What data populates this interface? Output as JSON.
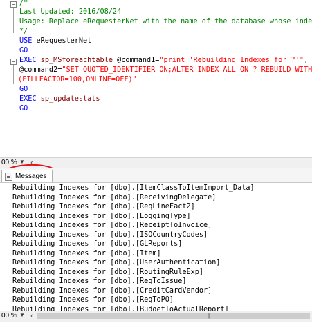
{
  "editor": {
    "lines": [
      {
        "text": "/*",
        "cls": "cm"
      },
      {
        "text": "Last Updated: 2016/08/24",
        "cls": "cm"
      },
      {
        "text": "Usage: Replace eRequesterNet with the name of the database whose indexes.",
        "cls": "cm"
      },
      {
        "text": "*/",
        "cls": "cm"
      }
    ],
    "use_kw": "USE",
    "use_db": " eRequesterNet",
    "go1": "GO",
    "exec_kw": "EXEC",
    "exec_proc": " sp_MSforeachtable",
    "exec_param1": " @command1=",
    "exec_str1": "\"print 'Rebuilding Indexes for ?'\"",
    "exec_comma": ",",
    "cmd2_param": "@command2=",
    "cmd2_str": "\"SET QUOTED_IDENTIFIER ON;ALTER INDEX ALL ON ? REBUILD WITH",
    "cmd2_cont": "(FILLFACTOR=100,ONLINE=OFF)\"",
    "go2": "GO",
    "exec2_kw": "EXEC",
    "exec2_proc": " sp_updatestats",
    "go3": "GO"
  },
  "zoom_top": "00 %",
  "zoom_bottom": "00 %",
  "tab_label": "Messages",
  "messages": [
    "Rebuilding Indexes for [dbo].[ItemClassToItemImport_Data]",
    "Rebuilding Indexes for [dbo].[ReceivingDelegate]",
    "Rebuilding Indexes for [dbo].[ReqLineFact2]",
    "Rebuilding Indexes for [dbo].[LoggingType]",
    "Rebuilding Indexes for [dbo].[ReceiptToInvoice]",
    "Rebuilding Indexes for [dbo].[ISOCountryCodes]",
    "Rebuilding Indexes for [dbo].[GLReports]",
    "Rebuilding Indexes for [dbo].[Item]",
    "Rebuilding Indexes for [dbo].[UserAuthentication]",
    "Rebuilding Indexes for [dbo].[RoutingRuleExp]",
    "Rebuilding Indexes for [dbo].[ReqToIssue]",
    "Rebuilding Indexes for [dbo].[CreditCardVendor]",
    "Rebuilding Indexes for [dbo].[ReqToPO]",
    "Rebuilding Indexes for [dbo].[BudgetToActualReport]"
  ]
}
